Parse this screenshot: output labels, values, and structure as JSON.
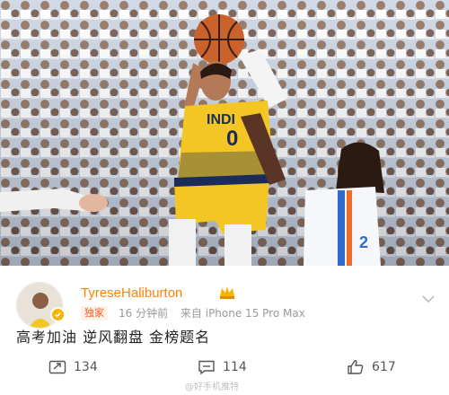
{
  "post": {
    "author": "TyreseHaliburton",
    "tag": "独家",
    "time": "16 分钟前",
    "source": "来自 iPhone 15 Pro Max",
    "text": "高考加油 逆风翻盘 金榜题名"
  },
  "photo": {
    "jersey_text": "INDI",
    "jersey_number": "0",
    "opponent_number": "2"
  },
  "actions": {
    "reposts": "134",
    "comments": "114",
    "likes": "617"
  },
  "watermark": "@好手机推特",
  "colors": {
    "accent": "#ff8200",
    "pacers_yellow": "#f3c623",
    "pacers_navy": "#1b2c5a",
    "text": "#222222",
    "muted": "#9a9a9a"
  },
  "icons": [
    "repost-icon",
    "comment-icon",
    "like-icon",
    "verified-icon",
    "crown-icon",
    "chevron-down-icon"
  ]
}
